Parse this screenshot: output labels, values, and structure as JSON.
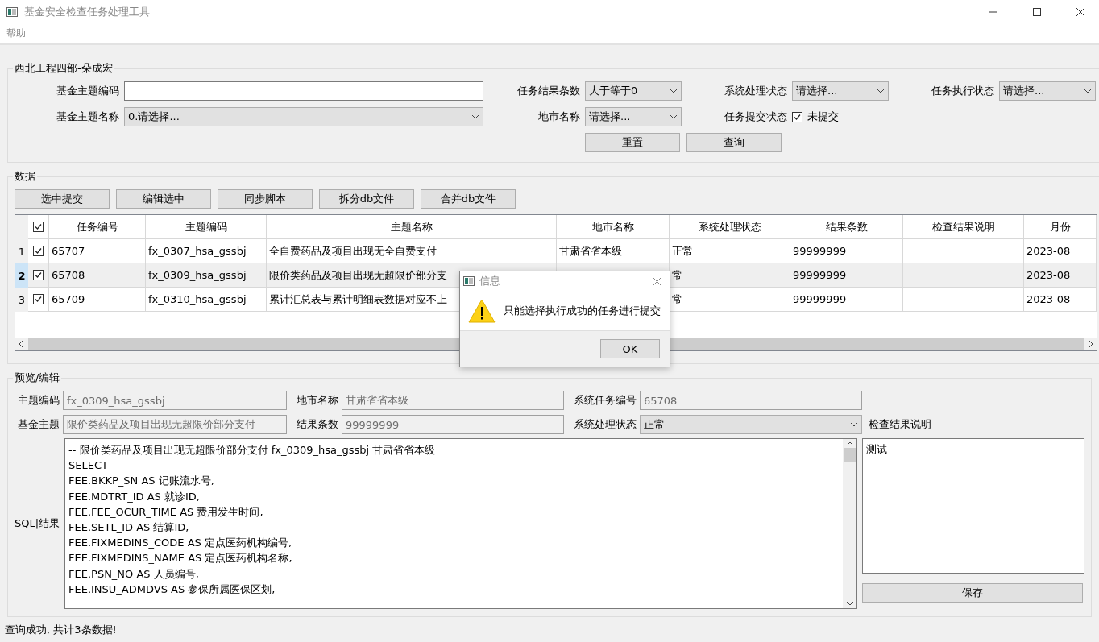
{
  "window": {
    "title": "基金安全检查任务处理工具"
  },
  "menu": [
    {
      "label": "帮助"
    }
  ],
  "filter": {
    "title": "西北工程四部-朵成宏",
    "fund_code": {
      "label": "基金主题编码"
    },
    "fund_name": {
      "label": "基金主题名称",
      "value": "0.请选择..."
    },
    "result_count": {
      "label": "任务结果条数",
      "value": "大于等于0"
    },
    "region": {
      "label": "地市名称",
      "value": "请选择..."
    },
    "sys_status": {
      "label": "系统处理状态",
      "value": "请选择..."
    },
    "submit_status": {
      "label": "任务提交状态",
      "option": "未提交",
      "checked": true
    },
    "exec_status": {
      "label": "任务执行状态",
      "value": "请选择..."
    },
    "buttons": [
      "重置",
      "查询"
    ]
  },
  "data": {
    "title": "数据",
    "buttons": [
      "选中提交",
      "编辑选中",
      "同步脚本",
      "拆分db文件",
      "合并db文件"
    ],
    "header_checked": true,
    "columns": [
      "任务编号",
      "主题编码",
      "主题名称",
      "地市名称",
      "系统处理状态",
      "结果条数",
      "检查结果说明",
      "月份"
    ],
    "rows": [
      {
        "num": "1",
        "checked": true,
        "selected": false,
        "cells": [
          "65707",
          "fx_0307_hsa_gssbj",
          "全自费药品及项目出现无全自费支付",
          "甘肃省省本级",
          "正常",
          "99999999",
          "",
          "2023-08"
        ]
      },
      {
        "num": "2",
        "checked": true,
        "selected": true,
        "cells": [
          "65708",
          "fx_0309_hsa_gssbj",
          "限价类药品及项目出现无超限价部分支",
          null,
          "常",
          "99999999",
          "",
          "2023-08"
        ]
      },
      {
        "num": "3",
        "checked": true,
        "selected": false,
        "cells": [
          "65709",
          "fx_0310_hsa_gssbj",
          "累计汇总表与累计明细表数据对应不上",
          null,
          "常",
          "99999999",
          "",
          "2023-08"
        ]
      }
    ]
  },
  "preview": {
    "title": "预览/编辑",
    "topic_code": {
      "label": "主题编码",
      "value": "fx_0309_hsa_gssbj",
      "disabled": true
    },
    "region": {
      "label": "地市名称",
      "value": "甘肃省省本级",
      "disabled": true
    },
    "task_id": {
      "label": "系统任务编号",
      "value": "65708",
      "disabled": true
    },
    "topic": {
      "label": "基金主题",
      "value": "限价类药品及项目出现无超限价部分支付",
      "disabled": true
    },
    "count": {
      "label": "结果条数",
      "value": "99999999",
      "disabled": true
    },
    "sys_status": {
      "label": "系统处理状态",
      "value": "正常"
    },
    "note_label": "检查结果说明",
    "sql_label": "SQL|结果",
    "sql_lines": [
      "-- 限价类药品及项目出现无超限价部分支付 fx_0309_hsa_gssbj 甘肃省省本级",
      "SELECT",
      "FEE.BKKP_SN AS 记账流水号,",
      "FEE.MDTRT_ID AS 就诊ID,",
      "FEE.FEE_OCUR_TIME AS 费用发生时间,",
      "FEE.SETL_ID AS 结算ID,",
      "FEE.FIXMEDINS_CODE AS 定点医药机构编号,",
      "FEE.FIXMEDINS_NAME AS 定点医药机构名称,",
      "FEE.PSN_NO AS 人员编号,",
      "FEE.INSU_ADMDVS AS 参保所属医保区划,"
    ],
    "note": "测试",
    "save": "保存"
  },
  "status_bar": "查询成功, 共计3条数据!",
  "dialog": {
    "title": "信息",
    "message": "只能选择执行成功的任务进行提交",
    "button": "OK"
  }
}
